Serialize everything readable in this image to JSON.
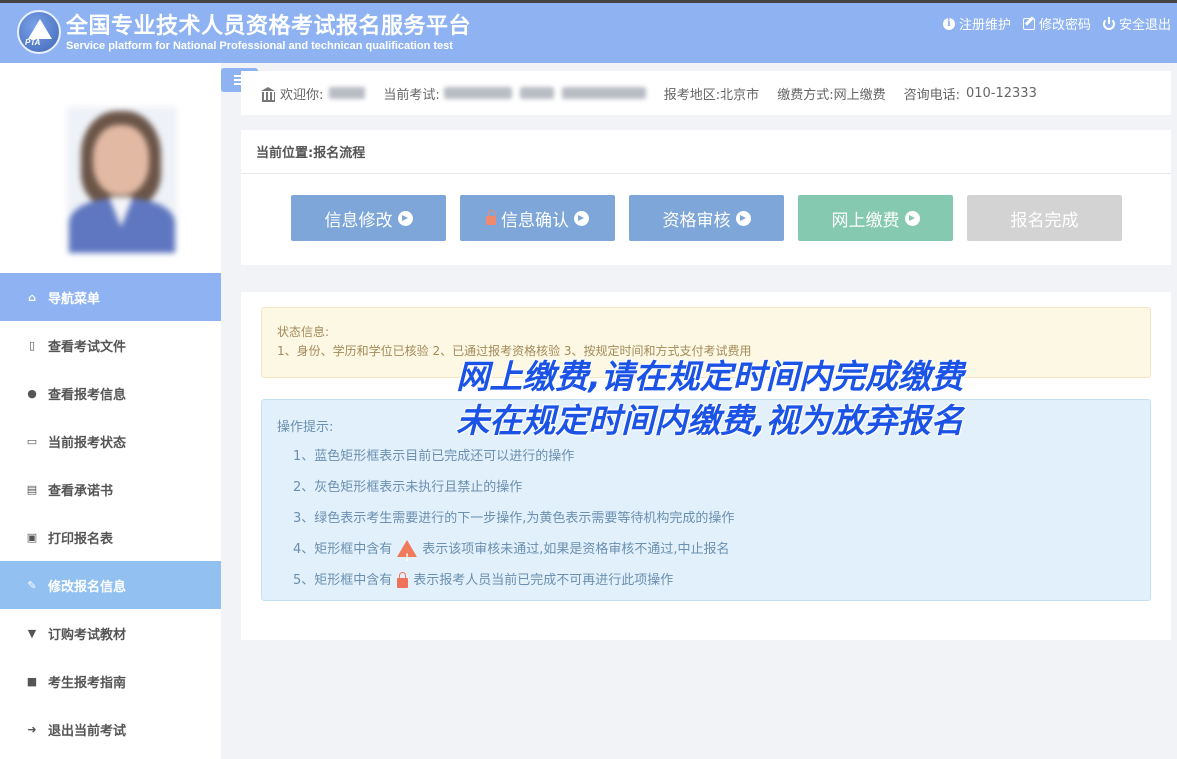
{
  "header": {
    "title_cn": "全国专业技术人员资格考试报名服务平台",
    "title_en": "Service platform for National Professional and technican qualification test",
    "logo_text": "PTA",
    "links": [
      "注册维护",
      "修改密码",
      "安全退出"
    ]
  },
  "sidebar": {
    "items": [
      {
        "label": "导航菜单",
        "icon": "home-icon"
      },
      {
        "label": "查看考试文件",
        "icon": "file-icon"
      },
      {
        "label": "查看报考信息",
        "icon": "info-icon"
      },
      {
        "label": "当前报考状态",
        "icon": "monitor-icon"
      },
      {
        "label": "查看承诺书",
        "icon": "newspaper-icon"
      },
      {
        "label": "打印报名表",
        "icon": "print-icon"
      },
      {
        "label": "修改报名信息",
        "icon": "edit-icon"
      },
      {
        "label": "订购考试教材",
        "icon": "cart-icon"
      },
      {
        "label": "考生报考指南",
        "icon": "book-icon"
      },
      {
        "label": "退出当前考试",
        "icon": "exit-icon"
      }
    ]
  },
  "infobar": {
    "welcome_label": "欢迎你:",
    "current_exam_label": "当前考试:",
    "region_label": "报考地区:",
    "region_value": "北京市",
    "payment_label": "缴费方式:",
    "payment_value": "网上缴费",
    "phone_label": "咨询电话:",
    "phone_value": "010-12333"
  },
  "flow": {
    "breadcrumb": "当前位置:报名流程",
    "steps": [
      {
        "label": "信息修改",
        "state": "blue"
      },
      {
        "label": "信息确认",
        "state": "blue",
        "locked": true
      },
      {
        "label": "资格审核",
        "state": "blue"
      },
      {
        "label": "网上缴费",
        "state": "green"
      },
      {
        "label": "报名完成",
        "state": "gray"
      }
    ]
  },
  "status": {
    "title": "状态信息:",
    "text": "1、身份、学历和学位已核验 2、已通过报考资格核验 3、按规定时间和方式支付考试费用"
  },
  "ops": {
    "title": "操作提示:",
    "item1": "1、蓝色矩形框表示目前已完成还可以进行的操作",
    "item2": "2、灰色矩形框表示未执行且禁止的操作",
    "item3": "3、绿色表示考生需要进行的下一步操作,为黄色表示需要等待机构完成的操作",
    "item4_pre": "4、矩形框中含有",
    "item4_post": "表示该项审核未通过,如果是资格审核不通过,中止报名",
    "item5_pre": "5、矩形框中含有",
    "item5_post": "表示报考人员当前已完成不可再进行此项操作"
  },
  "overlay": {
    "line1": "网上缴费,请在规定时间内完成缴费",
    "line2": "未在规定时间内缴费,视为放弃报名"
  },
  "colors": {
    "header_bg": "#8fb3f2",
    "step_blue": "#7ea6d8",
    "step_green": "#86c9b1",
    "step_gray": "#d3d3d3",
    "overlay_text": "#1b53e6"
  }
}
